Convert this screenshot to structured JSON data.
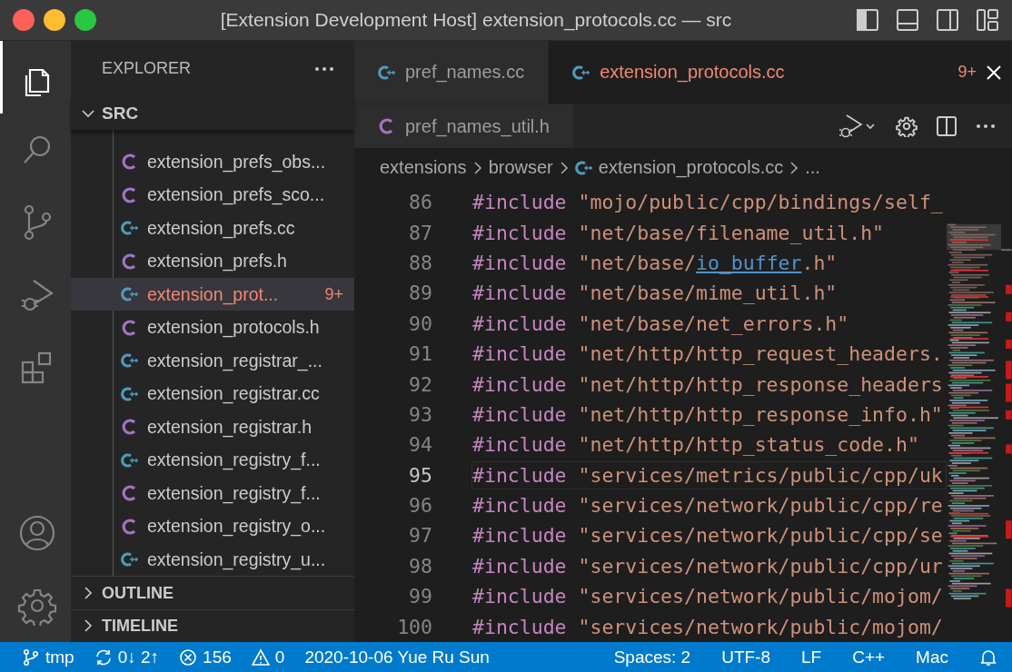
{
  "window": {
    "title": "[Extension Development Host] extension_protocols.cc — src"
  },
  "activity_bar": {
    "items": [
      {
        "kind": "files",
        "selected": true
      },
      {
        "kind": "search",
        "selected": false
      },
      {
        "kind": "source-control",
        "selected": false
      },
      {
        "kind": "run-debug",
        "selected": false
      },
      {
        "kind": "extensions",
        "selected": false
      }
    ],
    "bottom": [
      {
        "kind": "account"
      },
      {
        "kind": "settings"
      }
    ]
  },
  "sidebar": {
    "title": "EXPLORER",
    "folder": {
      "label": "SRC",
      "expanded": true
    },
    "items": [
      {
        "name": "extension_prefs_obs...",
        "kind": "c",
        "selected": false,
        "error": false
      },
      {
        "name": "extension_prefs_sco...",
        "kind": "c",
        "selected": false,
        "error": false
      },
      {
        "name": "extension_prefs.cc",
        "kind": "cpp",
        "selected": false,
        "error": false
      },
      {
        "name": "extension_prefs.h",
        "kind": "c",
        "selected": false,
        "error": false
      },
      {
        "name": "extension_prot...",
        "kind": "cpp",
        "selected": true,
        "error": true,
        "badge": "9+"
      },
      {
        "name": "extension_protocols.h",
        "kind": "c",
        "selected": false,
        "error": false
      },
      {
        "name": "extension_registrar_...",
        "kind": "cpp",
        "selected": false,
        "error": false
      },
      {
        "name": "extension_registrar.cc",
        "kind": "cpp",
        "selected": false,
        "error": false
      },
      {
        "name": "extension_registrar.h",
        "kind": "c",
        "selected": false,
        "error": false
      },
      {
        "name": "extension_registry_f...",
        "kind": "cpp",
        "selected": false,
        "error": false
      },
      {
        "name": "extension_registry_f...",
        "kind": "c",
        "selected": false,
        "error": false
      },
      {
        "name": "extension_registry_o...",
        "kind": "c",
        "selected": false,
        "error": false
      },
      {
        "name": "extension_registry_u...",
        "kind": "cpp",
        "selected": false,
        "error": false
      }
    ],
    "sections": [
      {
        "label": "OUTLINE",
        "expanded": false
      },
      {
        "label": "TIMELINE",
        "expanded": false
      }
    ]
  },
  "editor": {
    "tab_rows": [
      [
        {
          "name": "pref_names.cc",
          "kind": "cpp",
          "selected": false,
          "error": false
        },
        {
          "name": "extension_protocols.cc",
          "kind": "cpp",
          "selected": true,
          "error": true,
          "badge": "9+"
        }
      ],
      [
        {
          "name": "pref_names_util.h",
          "kind": "c",
          "selected": false,
          "error": false
        }
      ]
    ],
    "breadcrumbs": [
      {
        "label": "extensions",
        "kind": "folder"
      },
      {
        "label": "browser",
        "kind": "folder"
      },
      {
        "label": "extension_protocols.cc",
        "kind": "cpp"
      },
      {
        "label": "...",
        "kind": "more"
      }
    ],
    "lines": [
      {
        "number": "86",
        "keyword": "#include",
        "text": "\"mojo/public/cpp/bindings/self_",
        "current": false
      },
      {
        "number": "87",
        "keyword": "#include",
        "text": "\"net/base/filename_util.h\"",
        "current": false
      },
      {
        "number": "88",
        "keyword": "#include",
        "text": "\"net/base/",
        "link": "io_buffer",
        "text_end": ".h\"",
        "current": false
      },
      {
        "number": "89",
        "keyword": "#include",
        "text": "\"net/base/mime_util.h\"",
        "current": false
      },
      {
        "number": "90",
        "keyword": "#include",
        "text": "\"net/base/net_errors.h\"",
        "current": false
      },
      {
        "number": "91",
        "keyword": "#include",
        "text": "\"net/http/http_request_headers.",
        "current": false
      },
      {
        "number": "92",
        "keyword": "#include",
        "text": "\"net/http/http_response_headers",
        "current": false
      },
      {
        "number": "93",
        "keyword": "#include",
        "text": "\"net/http/http_response_info.h\"",
        "current": false
      },
      {
        "number": "94",
        "keyword": "#include",
        "text": "\"net/http/http_status_code.h\"",
        "current": false
      },
      {
        "number": "95",
        "keyword": "#include",
        "text": "\"services/metrics/public/cpp/uk",
        "current": true
      },
      {
        "number": "96",
        "keyword": "#include",
        "text": "\"services/network/public/cpp/re",
        "current": false
      },
      {
        "number": "97",
        "keyword": "#include",
        "text": "\"services/network/public/cpp/se",
        "current": false
      },
      {
        "number": "98",
        "keyword": "#include",
        "text": "\"services/network/public/cpp/ur",
        "current": false
      },
      {
        "number": "99",
        "keyword": "#include",
        "text": "\"services/network/public/mojom/",
        "current": false
      },
      {
        "number": "100",
        "keyword": "#include",
        "text": "\"services/network/public/mojom/",
        "current": false
      }
    ]
  },
  "status_bar": {
    "left": [
      {
        "kind": "branch",
        "text": "tmp"
      },
      {
        "kind": "sync",
        "text": "0↓ 2↑"
      },
      {
        "kind": "errors",
        "text": "156"
      },
      {
        "kind": "warnings",
        "text": "0"
      },
      {
        "kind": "plain",
        "text": "2020-10-06 Yue Ru Sun"
      }
    ],
    "right": [
      {
        "kind": "plain",
        "text": "Spaces: 2"
      },
      {
        "kind": "plain",
        "text": "UTF-8"
      },
      {
        "kind": "plain",
        "text": "LF"
      },
      {
        "kind": "plain",
        "text": "C++"
      },
      {
        "kind": "plain",
        "text": "Mac"
      },
      {
        "kind": "bell"
      }
    ]
  }
}
